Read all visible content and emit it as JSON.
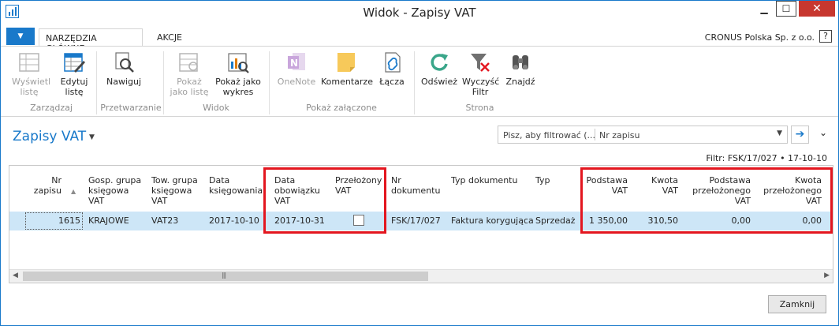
{
  "window": {
    "title": "Widok - Zapisy VAT",
    "company": "CRONUS Polska Sp. z o.o."
  },
  "ribbon_tabs": [
    "NARZĘDZIA GŁÓWNE",
    "AKCJE"
  ],
  "ribbon": {
    "buttons": {
      "show_list": "Wyświetl\nlistę",
      "edit_list": "Edytuj\nlistę",
      "navigate": "Nawiguj",
      "show_as_list": "Pokaż\njako listę",
      "show_as_chart": "Pokaż jako\nwykres",
      "onenote": "OneNote",
      "notes": "Komentarze",
      "links": "Łącza",
      "refresh": "Odśwież",
      "clear_filter": "Wyczyść\nFiltr",
      "find": "Znajdź"
    },
    "groups": {
      "manage": "Zarządzaj",
      "process": "Przetwarzanie",
      "view": "Widok",
      "attached": "Pokaż załączone",
      "page": "Strona"
    }
  },
  "page": {
    "title": "Zapisy VAT",
    "filter_placeholder": "Pisz, aby filtrować (...",
    "filter_field": "Nr zapisu",
    "filter_info": "Filtr: FSK/17/027 • 17-10-10"
  },
  "table": {
    "headers": {
      "entry_no": "Nr\nzapisu",
      "gen_bus": "Gosp. grupa\nksięgowa\nVAT",
      "gen_prod": "Tow. grupa\nksięgowa\nVAT",
      "posting_date": "Data\nksięgowania",
      "vat_date": "Data\nobowiązku\nVAT",
      "reversed": "Przełożony\nVAT",
      "doc_no": "Nr\ndokumentu",
      "doc_type": "Typ dokumentu",
      "type": "Typ",
      "base": "Podstawa\nVAT",
      "amount": "Kwota\nVAT",
      "rev_base": "Podstawa\nprzełożonego\nVAT",
      "rev_amount": "Kwota\nprzełożonego\nVAT"
    },
    "rows": [
      {
        "entry_no": "1615",
        "gen_bus": "KRAJOWE",
        "gen_prod": "VAT23",
        "posting_date": "2017-10-10",
        "vat_date": "2017-10-31",
        "reversed": false,
        "doc_no": "FSK/17/027",
        "doc_type": "Faktura korygująca",
        "type": "Sprzedaż",
        "base": "1 350,00",
        "amount": "310,50",
        "rev_base": "0,00",
        "rev_amount": "0,00"
      }
    ]
  },
  "close_button": "Zamknij",
  "colors": {
    "accent": "#1979ca",
    "selected_row": "#cde6f7",
    "highlight": "#e3161f",
    "close_hover": "#c7372f"
  },
  "icons": [
    "app-icon",
    "minimize-icon",
    "maximize-icon",
    "close-icon",
    "help-icon",
    "list-view-icon",
    "edit-list-icon",
    "navigate-icon",
    "show-as-list-icon",
    "chart-icon",
    "onenote-icon",
    "notes-icon",
    "links-icon",
    "refresh-icon",
    "clear-filter-icon",
    "find-icon",
    "dropdown-icon",
    "go-arrow-icon",
    "collapse-icon",
    "sort-ascending-icon"
  ]
}
